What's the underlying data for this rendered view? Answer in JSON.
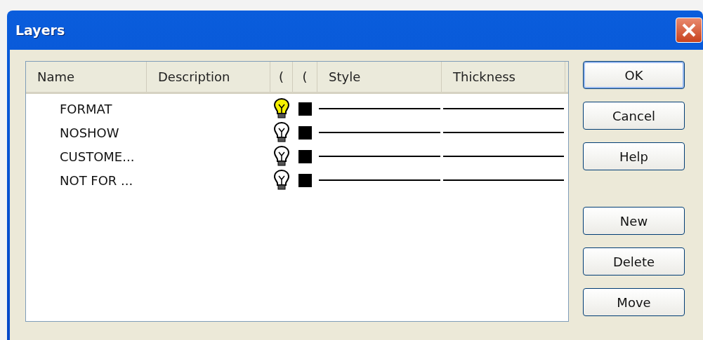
{
  "window": {
    "title": "Layers"
  },
  "table": {
    "columns": [
      "Name",
      "Description",
      "(",
      "(",
      "Style",
      "Thickness"
    ],
    "rows": [
      {
        "name": "FORMAT",
        "on": true,
        "color": "#000000"
      },
      {
        "name": "NOSHOW",
        "on": false,
        "color": "#000000"
      },
      {
        "name": "CUSTOME...",
        "on": false,
        "color": "#000000"
      },
      {
        "name": "NOT FOR ...",
        "on": false,
        "color": "#000000"
      }
    ]
  },
  "buttons": [
    {
      "label": "OK",
      "default": true
    },
    {
      "label": "Cancel",
      "default": false
    },
    {
      "label": "Help",
      "default": false
    }
  ],
  "layer_buttons": [
    {
      "label": "New",
      "default": false
    },
    {
      "label": "Delete",
      "default": false
    },
    {
      "label": "Move",
      "default": false
    }
  ]
}
